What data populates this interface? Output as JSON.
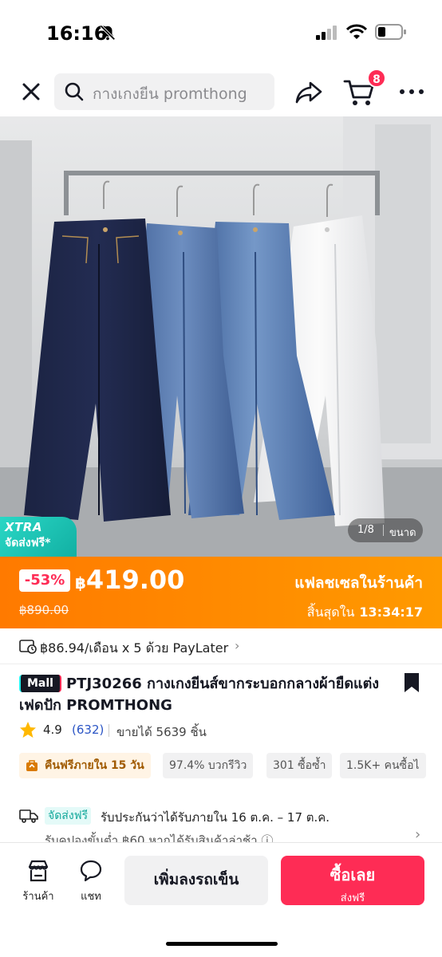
{
  "status_bar": {
    "time": "16:16"
  },
  "header": {
    "search_placeholder": "กางเกงยีน promthong",
    "cart_count": "8"
  },
  "gallery": {
    "xtra_title": "XTRA",
    "xtra_subtitle": "จัดส่งฟรี*",
    "image_index": "1/8",
    "size_label": "ขนาด"
  },
  "flash_sale": {
    "discount": "-53%",
    "currency": "฿",
    "price": "419.00",
    "original_price": "฿890.00",
    "title": "แฟลชเซลในร้านค้า",
    "ends_label": "สิ้นสุดใน",
    "countdown": "13:34:17"
  },
  "paylater": {
    "text": "฿86.94/เดือน x 5 ด้วย PayLater"
  },
  "product": {
    "mall_tag": "Mall",
    "title": "PTJ30266 กางเกงยีนส์ขากระบอกกลางผ้ายืดแต่งเฟดปัก PROMTHONG",
    "rating": "4.9",
    "review_count": "(632)",
    "sold": "ขายได้ 5639 ชิ้น"
  },
  "chips": {
    "returns": "คืนฟรีภายใน 15 วัน",
    "positive_reviews": "97.4% บวกรีวิว",
    "repeat_buyers": "301 ซื้อซ้ำ",
    "buyers": "1.5K+ คนซื้อไ"
  },
  "shipping": {
    "free_tag": "จัดส่งฟรี",
    "delivery": "รับประกันว่าได้รับภายใน 16 ต.ค. – 17 ต.ค.",
    "coupon": "รับคูปองขั้นต่ำ ฿60 หากได้รับสินค้าล่าช้า ⓘ"
  },
  "bottom_bar": {
    "shop_label": "ร้านค้า",
    "chat_label": "แชท",
    "add_to_cart": "เพิ่มลงรถเข็น",
    "buy_now": "ซื้อเลย",
    "buy_now_sub": "ส่งฟรี"
  },
  "colors": {
    "accent": "#fe2c55",
    "flash_orange": "#ff8a00",
    "xtra_teal": "#19c2b3"
  }
}
